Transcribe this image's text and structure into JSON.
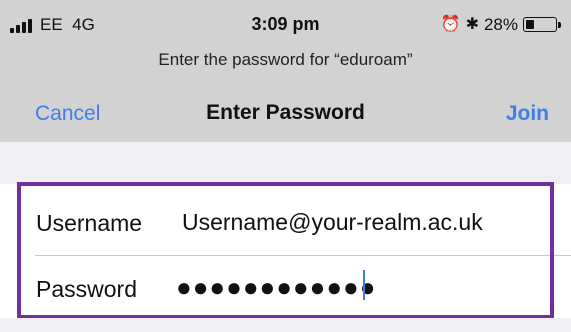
{
  "status_bar": {
    "carrier": "EE",
    "network": "4G",
    "time": "3:09 pm",
    "battery_percent": "28%",
    "battery_level": 0.28,
    "icons": [
      "signal-icon",
      "alarm-icon",
      "bluetooth-icon",
      "battery-icon"
    ]
  },
  "prompt": {
    "text": "Enter the password for “eduroam”"
  },
  "nav": {
    "cancel_label": "Cancel",
    "title": "Enter Password",
    "join_label": "Join"
  },
  "form": {
    "username_label": "Username",
    "username_value": "Username@your-realm.ac.uk",
    "password_label": "Password",
    "password_masked": "●●●●●●●●●●●●"
  },
  "colors": {
    "accent": "#3d7ee8",
    "highlight_border": "#7030a0",
    "header_bg": "#d2d2d2",
    "page_bg": "#efeff4"
  }
}
